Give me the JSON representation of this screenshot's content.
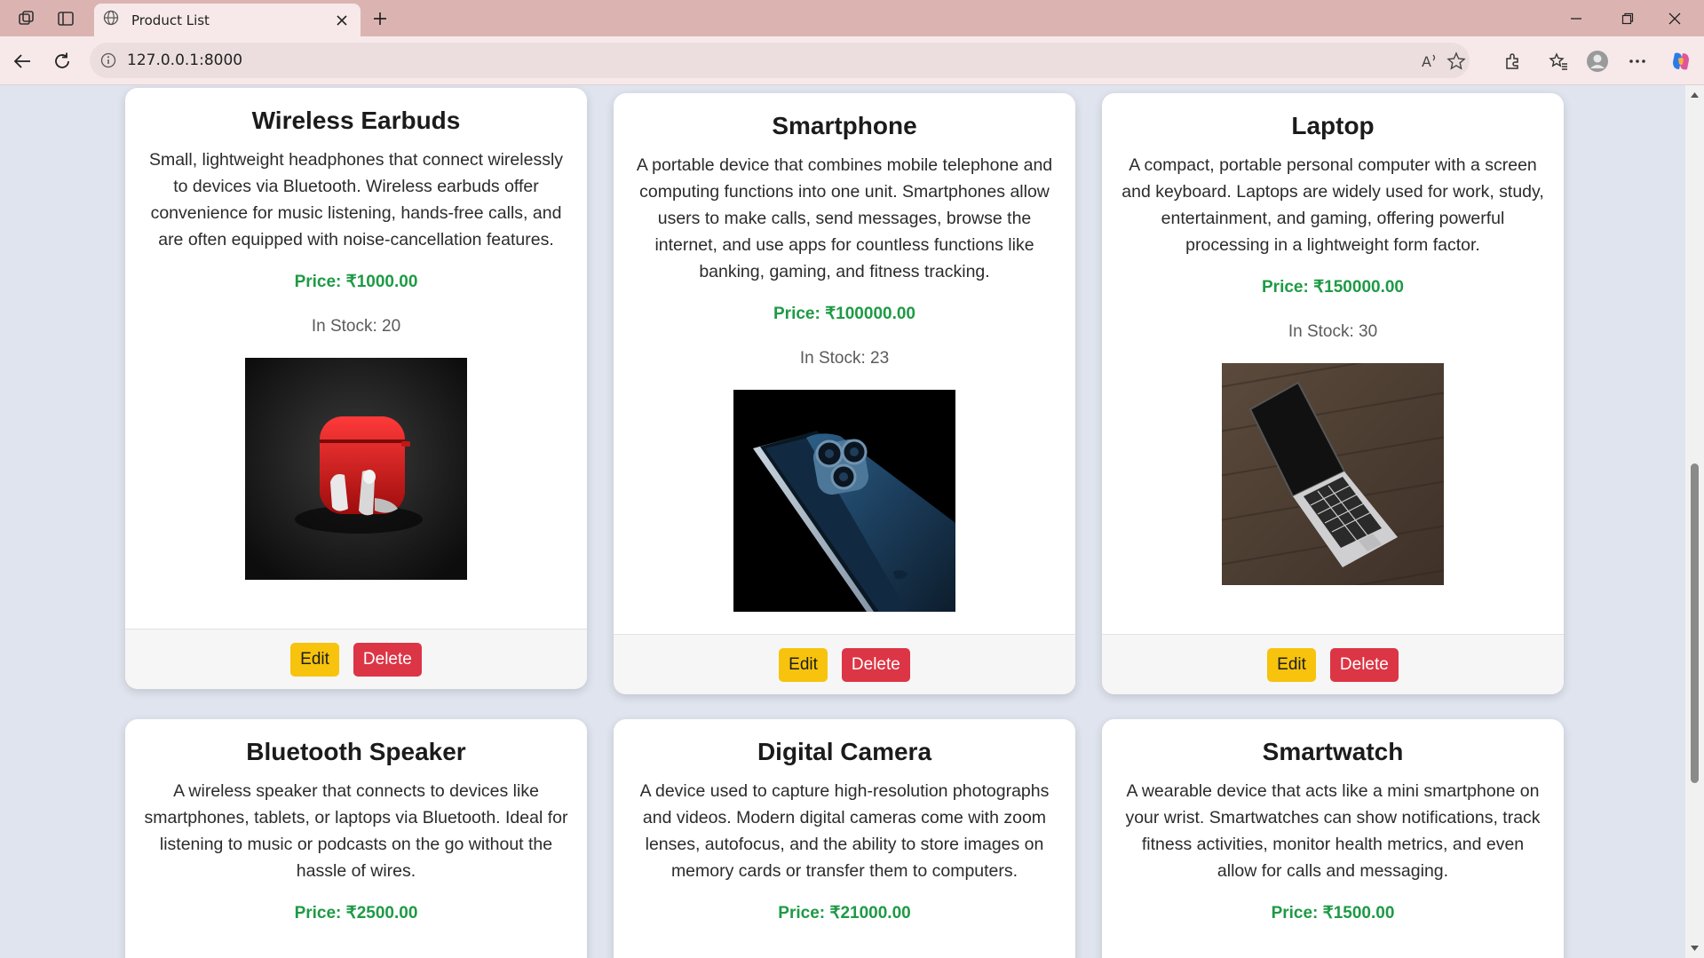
{
  "browser": {
    "tab_title": "Product List",
    "url": "127.0.0.1:8000"
  },
  "products": [
    {
      "name": "Wireless Earbuds",
      "description": "Small, lightweight headphones that connect wirelessly to devices via Bluetooth. Wireless earbuds offer convenience for music listening, hands-free calls, and are often equipped with noise-cancellation features.",
      "price": "Price: ₹1000.00",
      "stock": "In Stock: 20",
      "image": "earbuds-photo"
    },
    {
      "name": "Smartphone",
      "description": "A portable device that combines mobile telephone and computing functions into one unit. Smartphones allow users to make calls, send messages, browse the internet, and use apps for countless functions like banking, gaming, and fitness tracking.",
      "price": "Price: ₹100000.00",
      "stock": "In Stock: 23",
      "image": "smartphone-photo"
    },
    {
      "name": "Laptop",
      "description": "A compact, portable personal computer with a screen and keyboard. Laptops are widely used for work, study, entertainment, and gaming, offering powerful processing in a lightweight form factor.",
      "price": "Price: ₹150000.00",
      "stock": "In Stock: 30",
      "image": "laptop-photo"
    },
    {
      "name": "Bluetooth Speaker",
      "description": "A wireless speaker that connects to devices like smartphones, tablets, or laptops via Bluetooth. Ideal for listening to music or podcasts on the go without the hassle of wires.",
      "price": "Price: ₹2500.00"
    },
    {
      "name": "Digital Camera",
      "description": "A device used to capture high-resolution photographs and videos. Modern digital cameras come with zoom lenses, autofocus, and the ability to store images on memory cards or transfer them to computers.",
      "price": "Price: ₹21000.00"
    },
    {
      "name": "Smartwatch",
      "description": "A wearable device that acts like a mini smartphone on your wrist. Smartwatches can show notifications, track fitness activities, monitor health metrics, and even allow for calls and messaging.",
      "price": "Price: ₹1500.00"
    }
  ],
  "actions": {
    "edit_label": "Edit",
    "delete_label": "Delete"
  },
  "colors": {
    "price_green": "#1e9a45",
    "edit_yellow": "#f7c30d",
    "delete_red": "#dc3545",
    "page_background": "#dfe4ee",
    "titlebar": "#dbb4b2"
  }
}
